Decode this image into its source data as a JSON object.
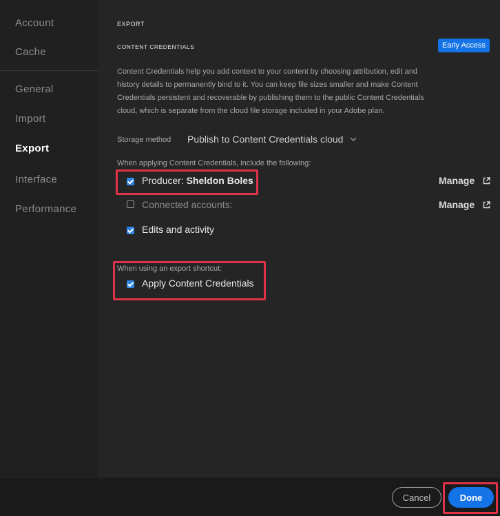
{
  "sidebar": {
    "items": [
      {
        "label": "Account",
        "active": false
      },
      {
        "label": "Cache",
        "active": false
      },
      {
        "label": "General",
        "active": false
      },
      {
        "label": "Import",
        "active": false
      },
      {
        "label": "Export",
        "active": true
      },
      {
        "label": "Interface",
        "active": false
      },
      {
        "label": "Performance",
        "active": false
      }
    ]
  },
  "main": {
    "section_title": "EXPORT",
    "subsection_title": "CONTENT CREDENTIALS",
    "badge": "Early Access",
    "description_lines": [
      "Content Credentials help you add context to your content by choosing attribution, edit and",
      "history details to permanently bind to it. You can keep file sizes smaller and make Content",
      "Credentials persistent and recoverable by publishing them to the public Content Credentials",
      "cloud, which is separate from the cloud file storage included in your Adobe plan."
    ],
    "storage_label": "Storage method",
    "storage_value": "Publish to Content Credentials cloud",
    "include_heading": "When applying Content Credentials, include the following:",
    "producer_label": "Producer:",
    "producer_name": "Sheldon Boles",
    "connected_label": "Connected accounts:",
    "edits_label": "Edits and activity",
    "manage_label": "Manage",
    "shortcut_heading": "When using an export shortcut:",
    "apply_label": "Apply Content Credentials"
  },
  "footer": {
    "cancel_label": "Cancel",
    "done_label": "Done"
  },
  "colors": {
    "accent": "#1473e6",
    "highlight": "#e0334a"
  }
}
